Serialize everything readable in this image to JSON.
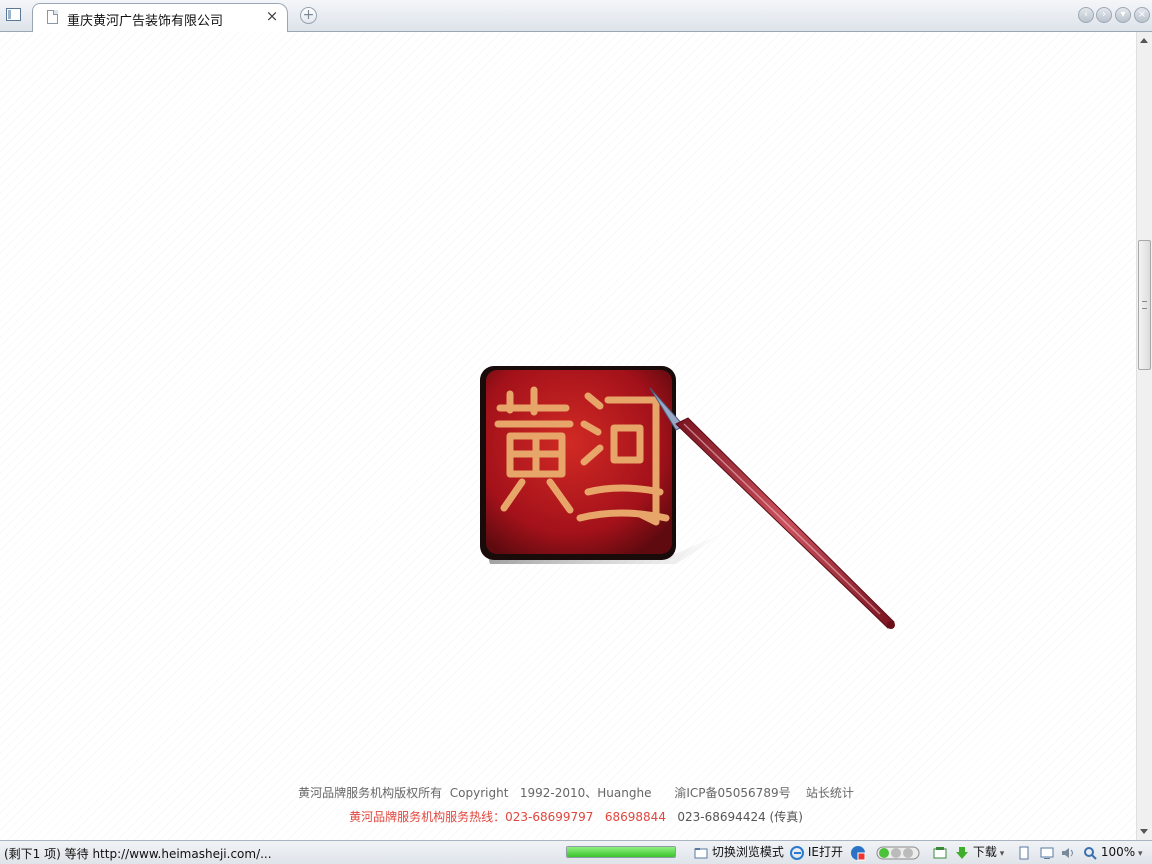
{
  "tabbar": {
    "tab_title": "重庆黄河广告装饰有限公司",
    "close_glyph": "×",
    "new_tab_glyph": "+"
  },
  "logo": {
    "seal_text": "黄河"
  },
  "footer": {
    "copyright": "黄河品牌服务机构版权所有  Copyright   1992-2010、Huanghe      渝ICP备05056789号    站长统计",
    "hotline_label": "黄河品牌服务机构服务热线：",
    "phone1": "023-68699797",
    "phone2": "68698844",
    "fax": "023-68694424 (传真)"
  },
  "statusbar": {
    "status_text": "(剩下1 项) 等待 http://www.heimasheji.com/...",
    "progress": 1.0,
    "mode_switch_label": "切换浏览模式",
    "ie_open_label": "IE打开",
    "download_label": "下载",
    "zoom_label": "100%"
  },
  "colors": {
    "seal_red": "#b3131a",
    "seal_text": "#e8a56a",
    "pen": "#a3202e",
    "hotline": "#e0463e"
  }
}
